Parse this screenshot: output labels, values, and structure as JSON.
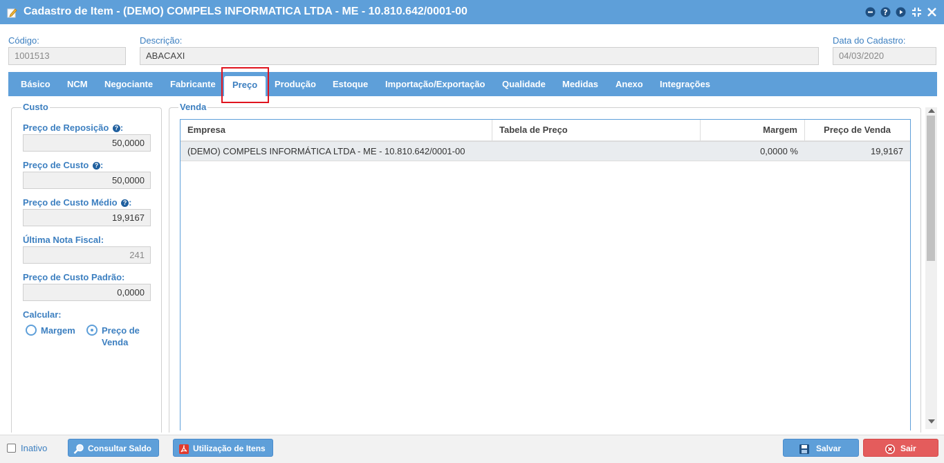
{
  "window": {
    "title": "Cadastro de Item - (DEMO) COMPELS INFORMATICA LTDA - ME - 10.810.642/0001-00"
  },
  "header": {
    "codigo_label": "Código:",
    "codigo_value": "1001513",
    "descricao_label": "Descrição:",
    "descricao_value": "ABACAXI",
    "data_label": "Data do Cadastro:",
    "data_value": "04/03/2020"
  },
  "tabs": [
    {
      "label": "Básico"
    },
    {
      "label": "NCM"
    },
    {
      "label": "Negociante"
    },
    {
      "label": "Fabricante"
    },
    {
      "label": "Preço"
    },
    {
      "label": "Produção"
    },
    {
      "label": "Estoque"
    },
    {
      "label": "Importação/Exportação"
    },
    {
      "label": "Qualidade"
    },
    {
      "label": "Medidas"
    },
    {
      "label": "Anexo"
    },
    {
      "label": "Integrações"
    }
  ],
  "custo": {
    "legend": "Custo",
    "reposicao_label": "Preço de Reposição",
    "reposicao_value": "50,0000",
    "custo_label": "Preço de Custo",
    "custo_value": "50,0000",
    "medio_label": "Preço de Custo Médio",
    "medio_value": "19,9167",
    "nota_label": "Última Nota Fiscal:",
    "nota_value": "241",
    "padrao_label": "Preço de Custo Padrão:",
    "padrao_value": "0,0000",
    "calcular_label": "Calcular:",
    "radio_margem": "Margem",
    "radio_preco_line1": "Preço de",
    "radio_preco_line2": "Venda",
    "selected": "Preço de Venda"
  },
  "venda": {
    "legend": "Venda",
    "columns": [
      "Empresa",
      "Tabela de Preço",
      "Margem",
      "Preço de Venda"
    ],
    "rows": [
      {
        "empresa": "(DEMO) COMPELS INFORMÁTICA LTDA - ME - 10.810.642/0001-00",
        "tabela": "",
        "margem": "0,0000 %",
        "preco": "19,9167"
      }
    ]
  },
  "footer": {
    "inativo_label": "Inativo",
    "consultar_label": "Consultar Saldo",
    "utilizacao_label": "Utilização de Itens",
    "salvar_label": "Salvar",
    "sair_label": "Sair"
  },
  "colors": {
    "accent": "#5e9fd9",
    "label": "#3c7fc0",
    "highlight": "#e0141e",
    "danger": "#e45c5c"
  },
  "icons": {
    "app": "edit-document-icon",
    "window_controls": [
      "minimize-icon",
      "help-icon",
      "play-icon",
      "compress-icon",
      "close-icon"
    ],
    "consultar": "search-icon",
    "utilizacao": "pdf-icon",
    "salvar": "save-icon",
    "sair": "close-circle-icon"
  }
}
